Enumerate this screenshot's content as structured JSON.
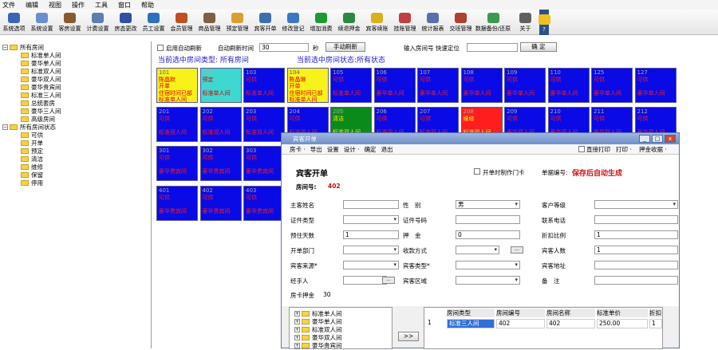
{
  "menubar": [
    "文件",
    "编辑",
    "视图",
    "操作",
    "工具",
    "窗口",
    "帮助"
  ],
  "toolbar": [
    {
      "label": "系统选项",
      "color": "#3b66b8"
    },
    {
      "label": "系统设置",
      "color": "#6a8fd1"
    },
    {
      "label": "客房设置",
      "color": "#8a5a2c"
    },
    {
      "label": "计费设置",
      "color": "#5a7fb0"
    },
    {
      "label": "房态更改",
      "color": "#3050a0"
    },
    {
      "label": "员工设置",
      "color": "#2f6fbf"
    },
    {
      "label": "会员管理",
      "color": "#c05020"
    },
    {
      "label": "商品管理",
      "color": "#806040"
    },
    {
      "label": "预定管理",
      "color": "#d9a030"
    },
    {
      "label": "宾客开单",
      "color": "#3a70b0"
    },
    {
      "label": "修改登记",
      "color": "#3a78c0"
    },
    {
      "label": "增加消费",
      "color": "#1e9a30"
    },
    {
      "label": "续退押金",
      "color": "#2a8a40"
    },
    {
      "label": "宾客续账",
      "color": "#d8b020"
    },
    {
      "label": "挂账管理",
      "color": "#c04040"
    },
    {
      "label": "统计报表",
      "color": "#5a6fb0"
    },
    {
      "label": "交班管理",
      "color": "#b04030"
    },
    {
      "label": "数据备份/还原",
      "color": "#3a9a50"
    },
    {
      "label": "关于",
      "color": "#606060"
    },
    {
      "label": "?",
      "color": "#f0c020"
    }
  ],
  "tree": {
    "root1": "所有房间",
    "types": [
      "标准单人间",
      "豪华单人间",
      "标准双人间",
      "豪华双人间",
      "豪华贵宾间",
      "标准三人间",
      "总统套房",
      "豪华三人间",
      "高级房间"
    ],
    "root2": "所有房间状态",
    "states": [
      "可供",
      "开单",
      "预定",
      "清洁",
      "维修",
      "保留",
      "停用"
    ]
  },
  "controls": {
    "auto_refresh_label": "启用自动刷新",
    "interval_label": "自动刷新时间",
    "interval_value": "30",
    "seconds_label": "秒",
    "manual_refresh": "手动刷新",
    "quick_locate_label": "输入房间号 快速定位",
    "confirm": "确 定",
    "type_status": "当前选中房间类型: 所有房间",
    "state_status": "当前选中房间状态:所有状态"
  },
  "rooms": {
    "row1": [
      {
        "no": "101",
        "lines": [
          "陈晶默",
          "开单",
          "住宿时间已部",
          "标准单人间"
        ],
        "color": "yellow"
      },
      {
        "no": "102",
        "lines": [
          "预定",
          "",
          "标准单人间"
        ],
        "color": "cyan"
      },
      {
        "no": "103",
        "lines": [
          "可供",
          "",
          "标准单人间"
        ],
        "color": "blue"
      },
      {
        "no": "104",
        "lines": [
          "陈晶琳",
          "开单",
          "住宿时间已部",
          "标准单人间"
        ],
        "color": "yellow"
      },
      {
        "no": "105",
        "lines": [
          "可供",
          "",
          "标准单人间"
        ],
        "color": "blue"
      },
      {
        "no": "106",
        "lines": [
          "可供",
          "",
          "豪华单人间"
        ],
        "color": "blue"
      },
      {
        "no": "107",
        "lines": [
          "可供",
          "",
          "豪华单人间"
        ],
        "color": "blue"
      },
      {
        "no": "108",
        "lines": [
          "可供",
          "",
          "豪华单人间"
        ],
        "color": "blue"
      },
      {
        "no": "109",
        "lines": [
          "可供",
          "",
          "豪华单人间"
        ],
        "color": "blue"
      },
      {
        "no": "110",
        "lines": [
          "可供",
          "",
          "豪华单人间"
        ],
        "color": "blue"
      },
      {
        "no": "125",
        "lines": [
          "可供",
          "",
          "豪华单人间"
        ],
        "color": "blue"
      },
      {
        "no": "127",
        "lines": [
          "可供",
          "",
          "豪华单人间"
        ],
        "color": "blue"
      }
    ],
    "row2": [
      {
        "no": "201",
        "lines": [
          "可供",
          "",
          "标准双人间"
        ],
        "color": "blue"
      },
      {
        "no": "202",
        "lines": [
          "可供",
          "",
          "标准双人间"
        ],
        "color": "blue"
      },
      {
        "no": "203",
        "lines": [
          "可供",
          "",
          "标准双人间"
        ],
        "color": "blue"
      },
      {
        "no": "204",
        "lines": [
          "可供",
          "",
          "标准双人间"
        ],
        "color": "blue"
      },
      {
        "no": "205",
        "lines": [
          "清洁",
          "",
          "标准双人间"
        ],
        "color": "green"
      },
      {
        "no": "206",
        "lines": [
          "可供",
          "",
          "标准双人间"
        ],
        "color": "blue"
      },
      {
        "no": "207",
        "lines": [
          "可供",
          "",
          "标准双人间"
        ],
        "color": "blue"
      },
      {
        "no": "208",
        "lines": [
          "维修",
          "",
          "标准双人间"
        ],
        "color": "red"
      },
      {
        "no": "209",
        "lines": [
          "可供",
          "",
          "豪华双人间"
        ],
        "color": "blue"
      },
      {
        "no": "210",
        "lines": [
          "可供",
          "",
          "豪华双人间"
        ],
        "color": "blue"
      },
      {
        "no": "211",
        "lines": [
          "可供",
          "",
          "豪华双人间"
        ],
        "color": "blue"
      },
      {
        "no": "212",
        "lines": [
          "可供",
          "",
          "豪华双人间"
        ],
        "color": "blue"
      }
    ],
    "row3": [
      {
        "no": "301",
        "lines": [
          "可供",
          "",
          "豪华贵宾间"
        ],
        "color": "blue"
      },
      {
        "no": "302",
        "lines": [
          "可供",
          "",
          "豪华贵宾间"
        ],
        "color": "blue"
      },
      {
        "no": "303",
        "lines": [
          "可供",
          "",
          "豪华贵宾间"
        ],
        "color": "blue"
      },
      {
        "no": "312",
        "lines": [
          "可供",
          "",
          "豪华三人间"
        ],
        "color": "blue"
      }
    ],
    "row4": [
      {
        "no": "401",
        "lines": [
          "可供",
          "",
          "豪华贵宾间"
        ],
        "color": "blue"
      },
      {
        "no": "402",
        "lines": [
          "可供",
          "",
          "豪华贵宾间"
        ],
        "color": "blue"
      },
      {
        "no": "403",
        "lines": [
          "可供",
          "",
          "豪华贵宾间"
        ],
        "color": "blue"
      },
      {
        "no": "412",
        "lines": [
          "可供",
          "",
          "高级房间"
        ],
        "color": "blue"
      }
    ]
  },
  "dialog": {
    "title": "宾客开单",
    "menu": [
      "房卡 ·",
      "导出",
      "设置",
      "设计 ·",
      "确定",
      "退出"
    ],
    "menu_right": [
      "直接打印",
      "打印 ·",
      "押金收据 ·"
    ],
    "heading": "宾客开单",
    "door_card": "开单时制作门卡",
    "order_no_label": "单据编号:",
    "order_no_value": "保存后自动生成",
    "room_no_label": "房间号:",
    "room_no_value": "402",
    "fields": {
      "guest_name": "主客姓名",
      "gender": "性　别",
      "gender_value": "男",
      "vip_level": "客户等级",
      "id_type": "证件类型",
      "id_no": "证件号码",
      "phone": "联系电话",
      "days": "预住天数",
      "days_value": "1",
      "deposit": "押　金",
      "deposit_value": "0",
      "discount": "折扣比例",
      "discount_value": "1",
      "dept": "开单部门",
      "pay": "收款方式",
      "guests": "宾客人数",
      "guests_value": "1",
      "source": "宾客来源*",
      "guest_type": "宾客类型*",
      "address": "宾客地址",
      "handler": "经手人",
      "area": "宾客区域",
      "remark": "备　注",
      "card_deposit": "房卡押金",
      "card_deposit_value": "30"
    },
    "dots": "...",
    "transfer_btn": ">>",
    "tree2": [
      "标准单人间",
      "豪华单人间",
      "标准双人间",
      "豪华双人间",
      "豪华贵宾间"
    ],
    "grid_headers": [
      "房间类型",
      "房间编号",
      "房间名称",
      "标准单价",
      "折扣"
    ],
    "grid_row": {
      "index": "1",
      "type": "标准三人间",
      "room_id": "402",
      "name": "402",
      "price": "250.00",
      "discount": "1"
    },
    "win_buttons": [
      "_",
      "□",
      "x"
    ]
  }
}
